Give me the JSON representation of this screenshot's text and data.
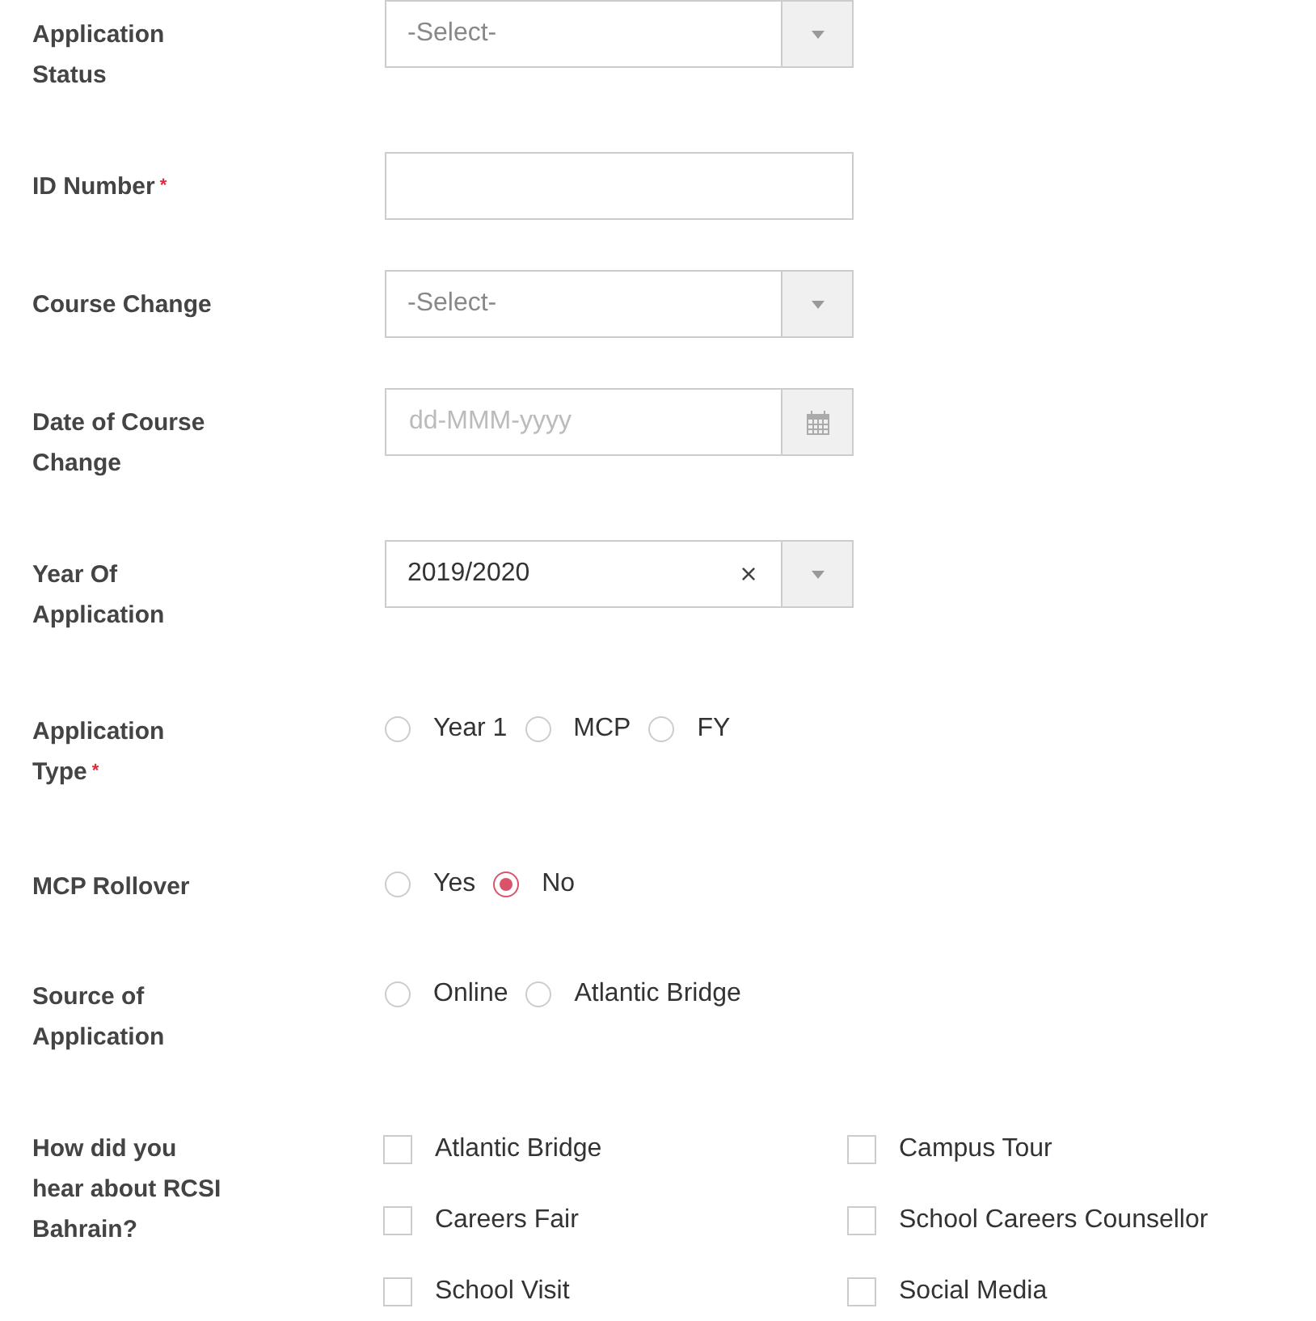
{
  "fields": [
    {
      "kind": "select",
      "label": "Application Status",
      "placeholder": "-Select-"
    },
    {
      "kind": "text",
      "label": "ID Number",
      "required_mark": "*"
    },
    {
      "kind": "select",
      "label": "Course Change",
      "placeholder": "-Select-"
    },
    {
      "kind": "date",
      "label": "Date of Course Change",
      "placeholder": "dd-MMM-yyyy"
    },
    {
      "kind": "select",
      "label": "Year Of Application",
      "value": "2019/2020",
      "clear": "×"
    },
    {
      "kind": "radio",
      "label": "Application Type",
      "required_mark": "*",
      "options": [
        {
          "label": "Year 1",
          "selected": false
        },
        {
          "label": "MCP",
          "selected": false
        },
        {
          "label": "FY",
          "selected": false
        }
      ]
    },
    {
      "kind": "radio",
      "label": "MCP Rollover",
      "options": [
        {
          "label": "Yes",
          "selected": false
        },
        {
          "label": "No",
          "selected": true
        }
      ]
    },
    {
      "kind": "radio",
      "label": "Source of Application",
      "options": [
        {
          "label": "Online",
          "selected": false
        },
        {
          "label": "Atlantic Bridge",
          "selected": false
        }
      ]
    },
    {
      "kind": "checkboxes",
      "label": "How did you hear about RCSI Bahrain?",
      "options": [
        {
          "label": "Atlantic Bridge",
          "checked": false
        },
        {
          "label": "Campus Tour",
          "checked": false
        },
        {
          "label": "Careers Fair",
          "checked": false
        },
        {
          "label": "School Careers Counsellor",
          "checked": false
        },
        {
          "label": "School Visit",
          "checked": false
        },
        {
          "label": "Social Media",
          "checked": false
        }
      ]
    }
  ]
}
